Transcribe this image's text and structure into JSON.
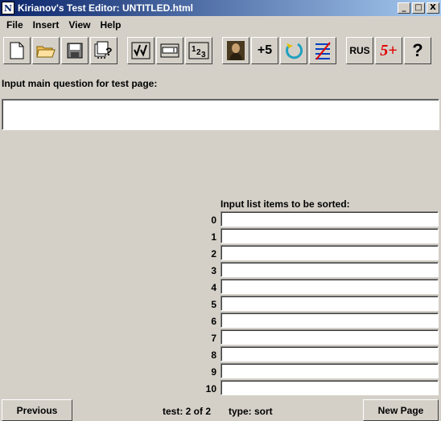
{
  "window": {
    "title": "Kirianov's Test Editor: UNTITLED.html",
    "controls": {
      "minimize": "_",
      "maximize": "□",
      "close": "X"
    }
  },
  "menu": [
    "File",
    "Insert",
    "View",
    "Help"
  ],
  "toolbar": {
    "buttons": [
      {
        "name": "new-file-icon"
      },
      {
        "name": "open-folder-icon"
      },
      {
        "name": "save-icon"
      },
      {
        "name": "print-test-icon"
      },
      {
        "name": "select-choice-icon"
      },
      {
        "name": "fill-input-icon"
      },
      {
        "name": "sort-numbers-icon",
        "label": "123"
      },
      {
        "name": "picture-icon"
      },
      {
        "name": "score-icon",
        "label": "+5"
      },
      {
        "name": "refresh-icon"
      },
      {
        "name": "checklist-icon"
      },
      {
        "name": "language-icon",
        "label": "RUS"
      },
      {
        "name": "grade-icon",
        "label": "5+"
      },
      {
        "name": "help-icon",
        "label": "?"
      }
    ]
  },
  "question": {
    "label": "Input main question for test page:",
    "value": ""
  },
  "sort_list": {
    "label": "Input list items to be sorted:",
    "items": [
      {
        "index": "0",
        "value": ""
      },
      {
        "index": "1",
        "value": ""
      },
      {
        "index": "2",
        "value": ""
      },
      {
        "index": "3",
        "value": ""
      },
      {
        "index": "4",
        "value": ""
      },
      {
        "index": "5",
        "value": ""
      },
      {
        "index": "6",
        "value": ""
      },
      {
        "index": "7",
        "value": ""
      },
      {
        "index": "8",
        "value": ""
      },
      {
        "index": "9",
        "value": ""
      },
      {
        "index": "10",
        "value": ""
      }
    ]
  },
  "footer": {
    "previous_label": "Previous",
    "test_status": "test: 2  of 2",
    "type_status": "type: sort",
    "new_page_label": "New Page"
  }
}
